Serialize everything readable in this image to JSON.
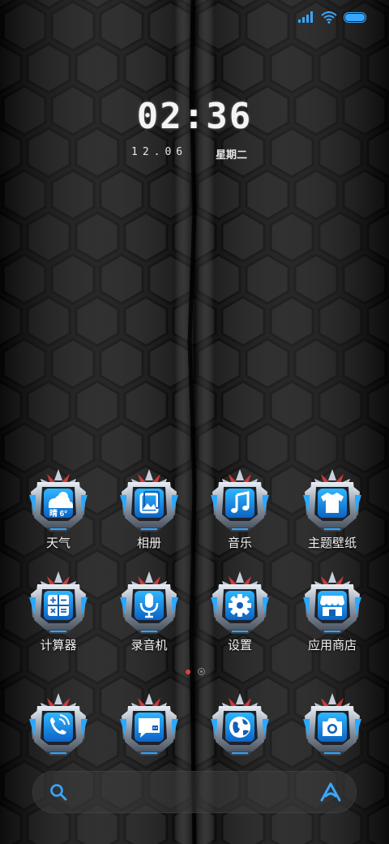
{
  "status_bar": {
    "signal_icon": "signal-icon",
    "wifi_icon": "wifi-icon",
    "battery_icon": "battery-icon",
    "battery_level": 1.0,
    "accent": "#38a7ff"
  },
  "lock": {
    "time": "02:36",
    "date": "12.06",
    "weekday": "星期二"
  },
  "apps": {
    "weather": {
      "label": "天气",
      "badge": "晴 6°",
      "icon": "weather-icon"
    },
    "gallery": {
      "label": "相册",
      "icon": "gallery-icon"
    },
    "music": {
      "label": "音乐",
      "icon": "music-icon"
    },
    "themes": {
      "label": "主题壁纸",
      "icon": "tshirt-icon"
    },
    "calculator": {
      "label": "计算器",
      "icon": "calculator-icon"
    },
    "recorder": {
      "label": "录音机",
      "icon": "microphone-icon"
    },
    "settings": {
      "label": "设置",
      "icon": "gear-icon"
    },
    "store": {
      "label": "应用商店",
      "icon": "store-icon"
    }
  },
  "dock": {
    "phone": {
      "icon": "phone-icon"
    },
    "messages": {
      "icon": "message-icon"
    },
    "browser": {
      "icon": "globe-icon"
    },
    "camera": {
      "icon": "camera-icon"
    }
  },
  "page_indicator": {
    "pages": 2,
    "current": 1,
    "active_color": "#e8403a"
  },
  "search": {
    "search_icon": "search-icon",
    "assistant_icon": "assistant-icon"
  },
  "colors": {
    "icon_blue": "#2aa8ff",
    "icon_blue_dark": "#0f5fb8",
    "frame_silver": "#b9c4d2",
    "frame_dark": "#2a2f38",
    "accent_red": "#d23a3a"
  }
}
